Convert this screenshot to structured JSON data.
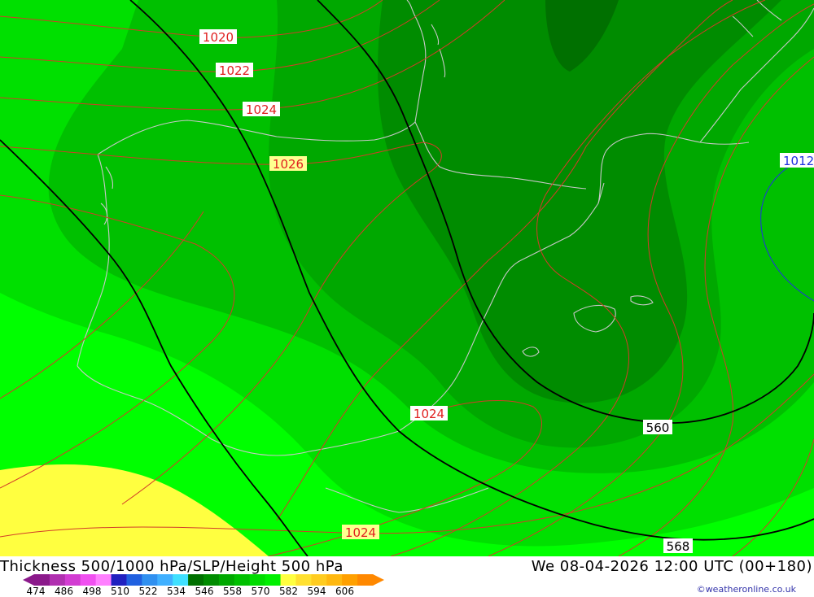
{
  "title": "Thickness 500/1000 hPa/SLP/Height 500 hPa",
  "datetime": "We 08-04-2026 12:00 UTC (00+180)",
  "credit": "©weatheronline.co.uk",
  "slp_labels": [
    "1020",
    "1022",
    "1024",
    "1026",
    "1024",
    "1024",
    "1012"
  ],
  "height_labels": [
    "560",
    "568"
  ],
  "legend": {
    "ticks": [
      "474",
      "486",
      "498",
      "510",
      "522",
      "534",
      "546",
      "558",
      "570",
      "582",
      "594",
      "606"
    ],
    "colors": [
      "#8b1a8b",
      "#b030b0",
      "#d23cd2",
      "#f050f0",
      "#ff80ff",
      "#2020c0",
      "#2060e0",
      "#3090f0",
      "#40b0ff",
      "#40e0ff",
      "#007000",
      "#008c00",
      "#00a800",
      "#00c000",
      "#00dc00",
      "#00f000",
      "#ffff40",
      "#ffe030",
      "#ffcc20",
      "#ffb810",
      "#ffa000",
      "#ff8800"
    ]
  },
  "palette": {
    "thickness_558": "#00ff00",
    "thickness_552": "#00e000",
    "thickness_546": "#00c000",
    "thickness_540": "#00a800",
    "thickness_534": "#008c00",
    "thickness_528": "#007000",
    "thickness_564": "#ffff40",
    "slp_contour": "#d23c28",
    "height_contour": "#000000",
    "coastline": "#c8c8c8"
  }
}
